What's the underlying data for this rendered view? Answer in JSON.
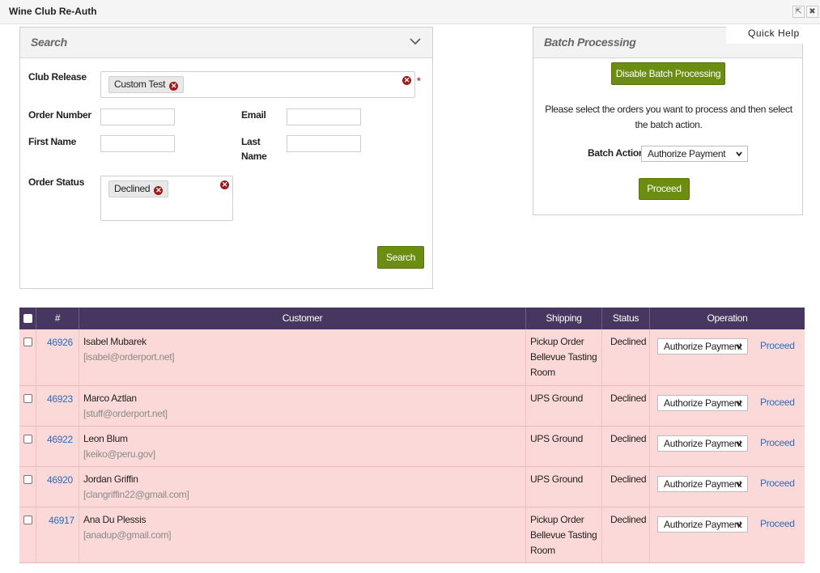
{
  "window": {
    "title": "Wine Club Re-Auth",
    "popout_icon": "popout-icon",
    "close_icon": "close-icon"
  },
  "search": {
    "title": "Search",
    "club_release_label": "Club Release",
    "club_release_tag": "Custom Test",
    "order_number_label": "Order Number",
    "email_label": "Email",
    "first_name_label": "First Name",
    "last_name_label": "Last Name",
    "order_status_label": "Order Status",
    "order_status_tag": "Declined",
    "search_button": "Search",
    "required_mark": "*"
  },
  "batch": {
    "title": "Batch Processing",
    "quick_help": "Quick Help",
    "disable_button": "Disable Batch Processing",
    "instructions": "Please select the orders you want to process and then select the batch action.",
    "action_label": "Batch Action",
    "action_value": "Authorize Payment",
    "proceed_button": "Proceed"
  },
  "table": {
    "headers": {
      "number": "#",
      "customer": "Customer",
      "shipping": "Shipping",
      "status": "Status",
      "operation": "Operation"
    },
    "rows": [
      {
        "order": "46926",
        "name": "Isabel Mubarek",
        "email": "[isabel@orderport.net]",
        "shipping_lines": [
          "Pickup Order",
          "Bellevue Tasting",
          "Room"
        ],
        "status": "Declined",
        "operation": "Authorize Payment",
        "link": "Proceed"
      },
      {
        "order": "46923",
        "name": "Marco Aztlan",
        "email": "[stuff@orderport.net]",
        "shipping_lines": [
          "UPS Ground"
        ],
        "status": "Declined",
        "operation": "Authorize Payment",
        "link": "Proceed"
      },
      {
        "order": "46922",
        "name": "Leon Blum",
        "email": "[keiko@peru.gov]",
        "shipping_lines": [
          "UPS Ground"
        ],
        "status": "Declined",
        "operation": "Authorize Payment",
        "link": "Proceed"
      },
      {
        "order": "46920",
        "name": "Jordan Griffin",
        "email": "[clangriffin22@gmail.com]",
        "shipping_lines": [
          "UPS Ground"
        ],
        "status": "Declined",
        "operation": "Authorize Payment",
        "link": "Proceed"
      },
      {
        "order": "46917",
        "name": "Ana Du Plessis",
        "email": "[anadup@gmail.com]",
        "shipping_lines": [
          "Pickup Order",
          "Bellevue Tasting",
          "Room"
        ],
        "status": "Declined",
        "operation": "Authorize Payment",
        "link": "Proceed"
      }
    ]
  },
  "colors": {
    "accent_green": "#6b8e12",
    "table_header": "#47365f",
    "row_declined": "#fcd9d9",
    "link_blue": "#2b6bb8",
    "remove_red": "#9b1c1c"
  }
}
